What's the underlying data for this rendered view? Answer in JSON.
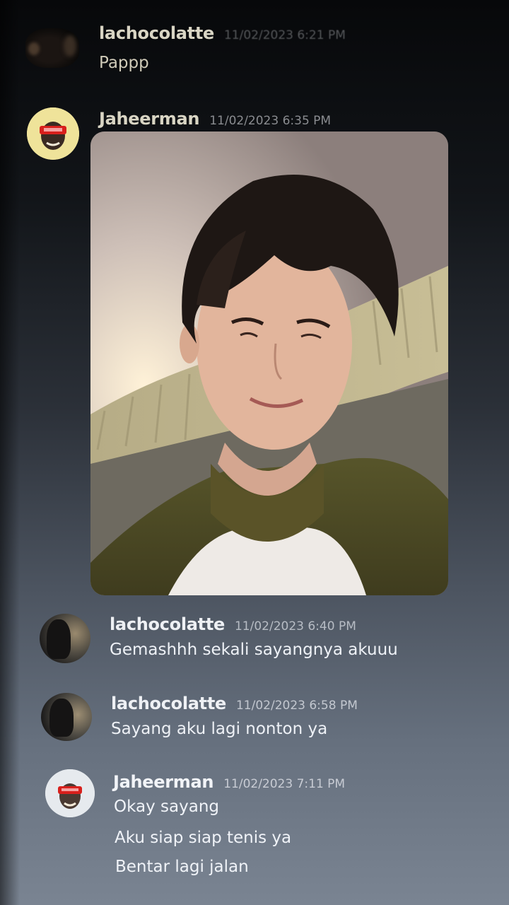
{
  "messages": [
    {
      "username": "lachocolatte",
      "timestamp": "11/02/2023 6:21 PM",
      "lines": [
        "Pappp"
      ]
    },
    {
      "username": "Jaheerman",
      "timestamp": "11/02/2023 6:35 PM",
      "attachment": "photo-attachment",
      "lines": []
    },
    {
      "username": "lachocolatte",
      "timestamp": "11/02/2023 6:40 PM",
      "lines": [
        "Gemashhh sekali sayangnya akuuu"
      ]
    },
    {
      "username": "lachocolatte",
      "timestamp": "11/02/2023 6:58 PM",
      "lines": [
        "Sayang aku lagi nonton ya"
      ]
    },
    {
      "username": "Jaheerman",
      "timestamp": "11/02/2023 7:11 PM",
      "lines": [
        "Okay sayang",
        "Aku siap siap tenis ya",
        "Bentar lagi jalan"
      ]
    }
  ],
  "colors": {
    "username_top": "#d9d5c4",
    "text_top": "#cfcab8",
    "username_bottom": "#f2f4f8",
    "text_bottom": "#eef1f6",
    "timestamp": "#9aa0aa",
    "avatar_yellow": "#efe39a",
    "avatar_red": "#d8201c"
  }
}
